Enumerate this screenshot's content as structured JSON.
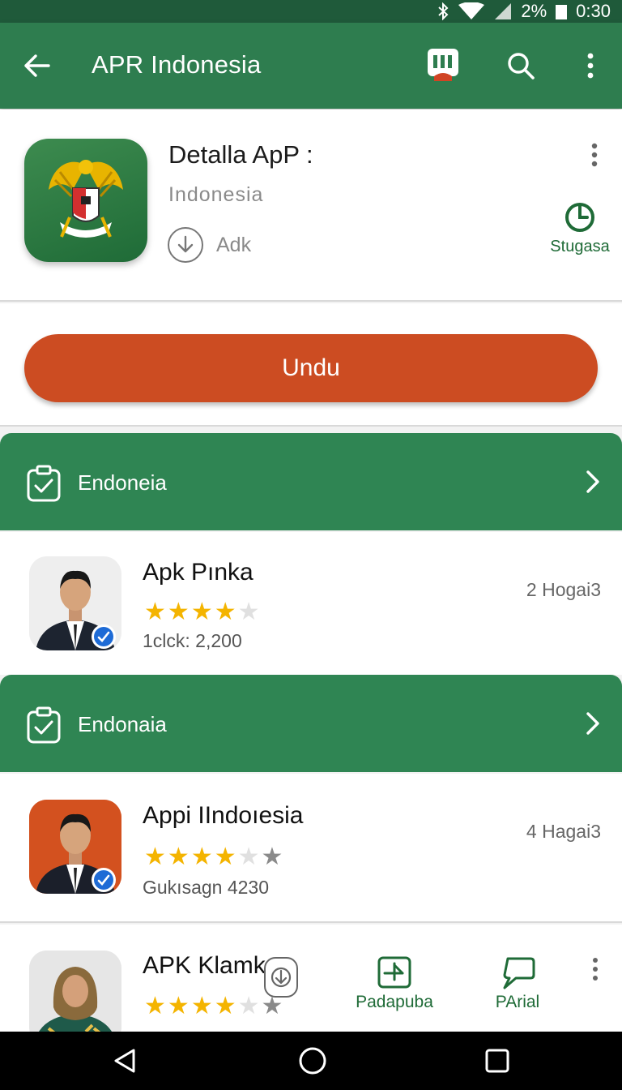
{
  "status_bar": {
    "battery": "2%",
    "time": "0:30"
  },
  "app_bar": {
    "title": "APR Indonesia"
  },
  "app_card": {
    "name": "Detalla ApP :",
    "developer": "Indonesia",
    "download_label": "Adk",
    "side_action_label": "Stugasa"
  },
  "install_button": {
    "label": "Undu"
  },
  "sections": [
    {
      "label": "Endoneia",
      "item": {
        "title": "Apk Pınka",
        "rating": 4,
        "sub": "1clck: 2,200",
        "meta": "2 Hogai3"
      }
    },
    {
      "label": "Endonaia",
      "item": {
        "title": "Appi IIndoıesia",
        "rating": 4,
        "sub": "Gukısagn 4230",
        "meta": "4 Hagai3"
      }
    }
  ],
  "last_item": {
    "title": "APK Klamk",
    "rating": 4,
    "action1_label": "Padapuba",
    "action2_label": "PArial"
  },
  "colors": {
    "green": "#2e7d4f",
    "green_dark": "#1f5a3a",
    "install_orange": "#cc4c22",
    "star": "#f4b400"
  }
}
